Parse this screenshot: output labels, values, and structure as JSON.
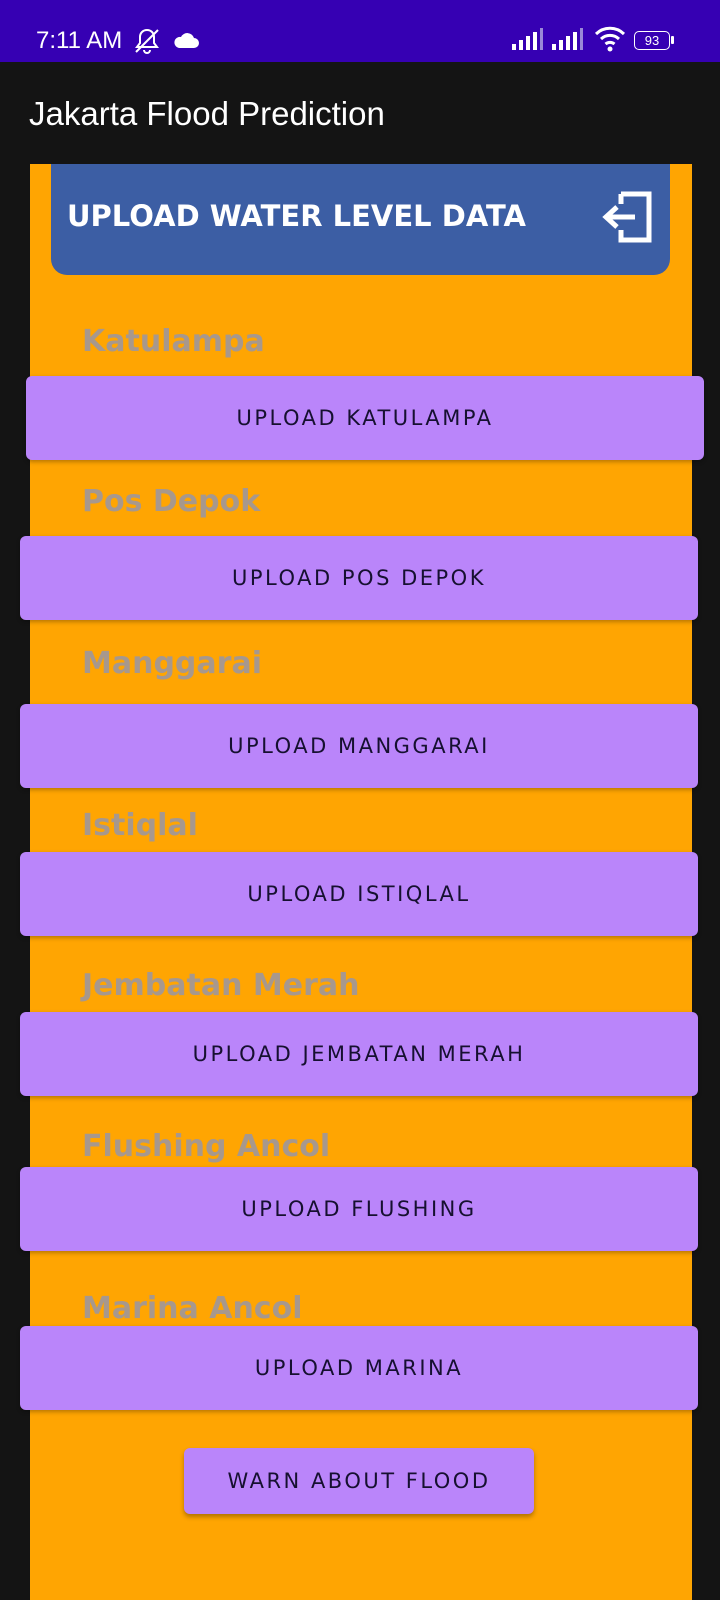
{
  "status_bar": {
    "time": "7:11 AM",
    "battery_level": "93",
    "icons": [
      "mute-icon",
      "cloud-icon",
      "signal-icon",
      "signal-icon",
      "wifi-icon",
      "battery-icon"
    ]
  },
  "app_bar": {
    "title": "Jakarta Flood Prediction"
  },
  "header": {
    "title": "UPLOAD WATER LEVEL DATA",
    "icon": "logout-icon"
  },
  "stations": [
    {
      "label": "Katulampa",
      "button": "UPLOAD KATULAMPA"
    },
    {
      "label": "Pos Depok",
      "button": "UPLOAD POS DEPOK"
    },
    {
      "label": "Manggarai",
      "button": "UPLOAD MANGGARAI"
    },
    {
      "label": "Istiqlal",
      "button": "UPLOAD ISTIQLAL"
    },
    {
      "label": "Jembatan Merah",
      "button": "UPLOAD JEMBATAN MERAH"
    },
    {
      "label": "Flushing Ancol",
      "button": "UPLOAD FLUSHING"
    },
    {
      "label": "Marina Ancol",
      "button": "UPLOAD MARINA"
    }
  ],
  "warn_button": "WARN ABOUT FLOOD",
  "colors": {
    "status_bar": "#3600b3",
    "app_bar": "#141414",
    "content_background": "#ffa502",
    "header_card": "#3c5ea4",
    "button": "#ba85fa",
    "station_label": "#a7988d"
  }
}
